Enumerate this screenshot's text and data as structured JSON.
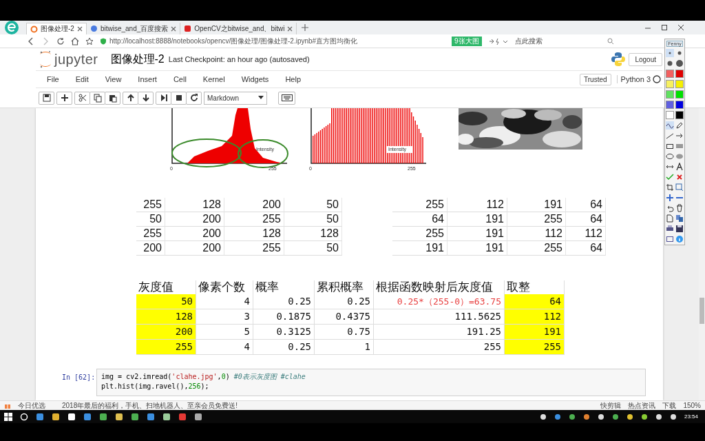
{
  "browser": {
    "tabs": [
      {
        "title": "图像处理-2",
        "selected": true
      },
      {
        "title": "bitwise_and_百度搜索",
        "selected": false
      },
      {
        "title": "OpenCV之bitwise_and、bitwi",
        "selected": false
      }
    ],
    "url": "http://localhost:8888/notebooks/opencv/图像处理/图像处理-2.ipynb#直方图均衡化",
    "badge": "9张大图",
    "search_placeholder": "点此搜索"
  },
  "jupyter": {
    "logo": "jupyter",
    "notebook_title": "图像处理-2",
    "checkpoint": "Last Checkpoint: an hour ago (autosaved)",
    "logout": "Logout",
    "menu": [
      "File",
      "Edit",
      "View",
      "Insert",
      "Cell",
      "Kernel",
      "Widgets",
      "Help"
    ],
    "trusted": "Trusted",
    "kernel": "Python 3",
    "cell_type": "Markdown"
  },
  "histograms": [
    {
      "label": "Intensity",
      "axis_start": "0",
      "axis_end": "255",
      "kind": "peaked",
      "circled": true
    },
    {
      "label": "Intensity",
      "axis_start": "0",
      "axis_end": "255",
      "kind": "spread",
      "circled": false
    }
  ],
  "table_before": [
    [
      "255",
      "128",
      "200",
      "50"
    ],
    [
      "50",
      "200",
      "255",
      "50"
    ],
    [
      "255",
      "200",
      "128",
      "128"
    ],
    [
      "200",
      "200",
      "255",
      "50"
    ]
  ],
  "table_after": [
    [
      "255",
      "112",
      "191",
      "64"
    ],
    [
      "64",
      "191",
      "255",
      "64"
    ],
    [
      "255",
      "191",
      "112",
      "112"
    ],
    [
      "191",
      "191",
      "255",
      "64"
    ]
  ],
  "mapping_table": {
    "columns": [
      {
        "title": "灰度值",
        "highlighted": true
      },
      {
        "title": "像素个数",
        "highlighted": false
      },
      {
        "title": "概率",
        "highlighted": false
      },
      {
        "title": "累积概率",
        "highlighted": false
      },
      {
        "title": "根据函数映射后灰度值",
        "highlighted": false
      },
      {
        "title": "取整",
        "highlighted": true
      }
    ],
    "rows": [
      {
        "cells": [
          "50",
          "4",
          "0.25",
          "0.25",
          "0.25*（255-0）=63.75",
          "64"
        ],
        "formula_shown": true
      },
      {
        "cells": [
          "128",
          "3",
          "0.1875",
          "0.4375",
          "111.5625",
          "112"
        ],
        "formula_shown": false
      },
      {
        "cells": [
          "200",
          "5",
          "0.3125",
          "0.75",
          "191.25",
          "191"
        ],
        "formula_shown": false
      },
      {
        "cells": [
          "255",
          "4",
          "0.25",
          "1",
          "255",
          "255"
        ],
        "formula_shown": false
      }
    ]
  },
  "code_cell": {
    "prompt": "In [62]:",
    "lines": [
      [
        {
          "text": "img = cv2.imread(",
          "kind": "plain"
        },
        {
          "text": "'clahe.jpg'",
          "kind": "str"
        },
        {
          "text": ",",
          "kind": "plain"
        },
        {
          "text": "0",
          "kind": "num"
        },
        {
          "text": ") ",
          "kind": "plain"
        },
        {
          "text": "#0表示灰度图 #clahe",
          "kind": "comment"
        }
      ],
      [
        {
          "text": "plt.hist(img.ravel(),",
          "kind": "plain"
        },
        {
          "text": "256",
          "kind": "num"
        },
        {
          "text": ");",
          "kind": "plain"
        }
      ]
    ]
  },
  "palette": {
    "label": "Fenny",
    "swatches": [
      {
        "color": "#f26060"
      },
      {
        "color": "#e00000"
      },
      {
        "color": "#f7f060"
      },
      {
        "color": "#f5f000"
      },
      {
        "color": "#60e060"
      },
      {
        "color": "#00e000"
      },
      {
        "color": "#6060e0"
      },
      {
        "color": "#0000e0"
      },
      {
        "color": "#ffffff"
      },
      {
        "color": "#000000"
      }
    ]
  },
  "status_bar": {
    "left": "今日优选",
    "news": "2018年最后的福利，手机、扫地机器人、至亲会员免费送!",
    "items": [
      "快剪辑",
      "热点资讯",
      "下载"
    ],
    "zoom": "150%"
  },
  "taskbar": {
    "clock": "23:54"
  }
}
